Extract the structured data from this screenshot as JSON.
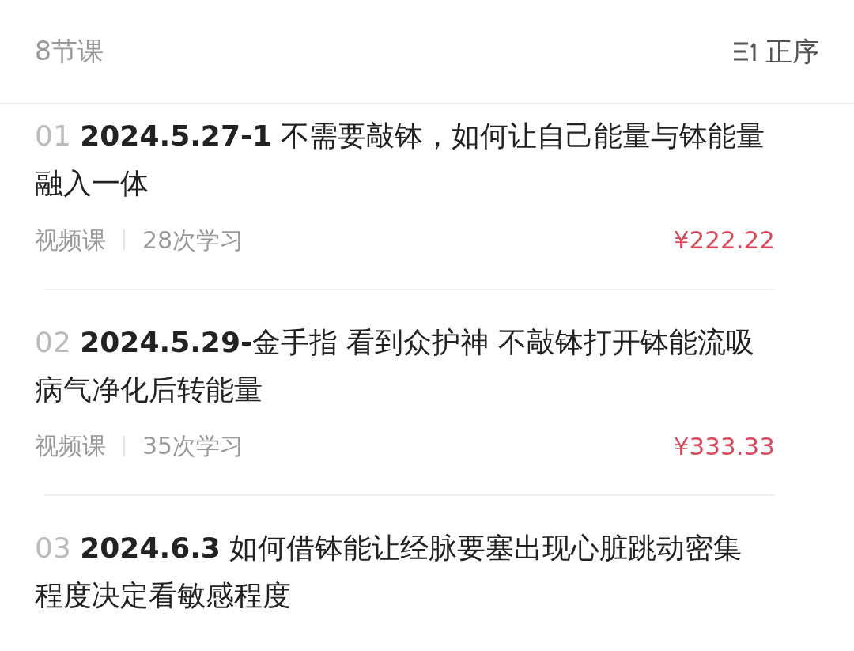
{
  "header": {
    "count": "8节课",
    "sort_label": "正序"
  },
  "lessons": [
    {
      "number": "01",
      "title": "**2024.5.27-1** 不需要敲钵，如何让自己能量与钵能量融入一体",
      "type": "视频课",
      "views": "28次学习",
      "price": "¥222.22"
    },
    {
      "number": "02",
      "title": "**2024.5.29-**金手指 看到众护神 不敲钵打开钵能流吸病气净化后转能量",
      "type": "视频课",
      "views": "35次学习",
      "price": "¥333.33"
    },
    {
      "number": "03",
      "title": "**2024.6.3** 如何借钵能让经脉要塞出现心脏跳动密集程度决定看敏感程度"
    }
  ]
}
